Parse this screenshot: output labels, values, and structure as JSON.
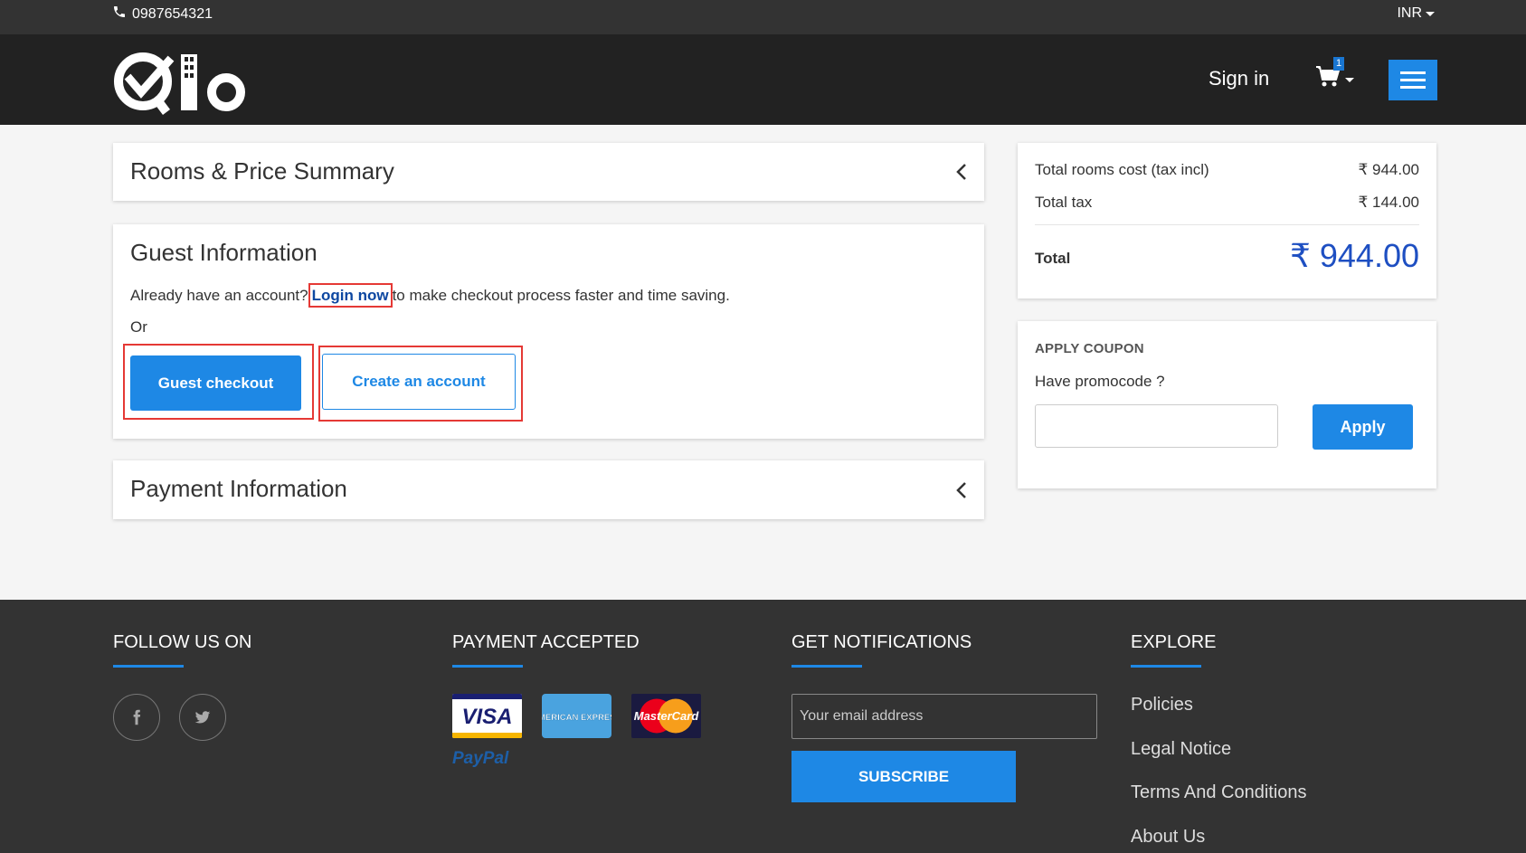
{
  "topbar": {
    "phone": "0987654321",
    "currency": "INR"
  },
  "header": {
    "signin_label": "Sign in",
    "cart_count": "1"
  },
  "rooms_panel": {
    "title": "Rooms & Price Summary"
  },
  "guest_panel": {
    "title": "Guest Information",
    "account_prefix": "Already have an account?",
    "login_link": "Login now",
    "account_suffix": "to make checkout process faster and time saving.",
    "or_label": "Or",
    "guest_checkout_label": "Guest checkout",
    "create_account_label": "Create an account"
  },
  "payment_panel": {
    "title": "Payment Information"
  },
  "summary": {
    "rooms_cost_label": "Total rooms cost (tax incl)",
    "rooms_cost_value": "₹ 944.00",
    "tax_label": "Total tax",
    "tax_value": "₹ 144.00",
    "total_label": "Total",
    "total_value": "₹ 944.00"
  },
  "coupon": {
    "heading": "APPLY COUPON",
    "question": "Have promocode ?",
    "input_value": "",
    "apply_label": "Apply"
  },
  "footer": {
    "follow_heading": "FOLLOW US ON",
    "payment_heading": "PAYMENT ACCEPTED",
    "notify_heading": "GET NOTIFICATIONS",
    "explore_heading": "EXPLORE",
    "email_placeholder": "Your email address",
    "subscribe_label": "SUBSCRIBE",
    "paypal_label": "PayPal",
    "explore_links": [
      "Policies",
      "Legal Notice",
      "Terms And Conditions",
      "About Us"
    ],
    "social_icons": [
      "facebook-icon",
      "twitter-icon"
    ],
    "cards": [
      "VISA",
      "AMERICAN EXPRESS",
      "MasterCard"
    ]
  },
  "colors": {
    "accent": "#1e88e5",
    "dark_bg": "#333333",
    "nav_bg": "#222222",
    "highlight": "#e53935",
    "total_blue": "#1e4fc2"
  }
}
